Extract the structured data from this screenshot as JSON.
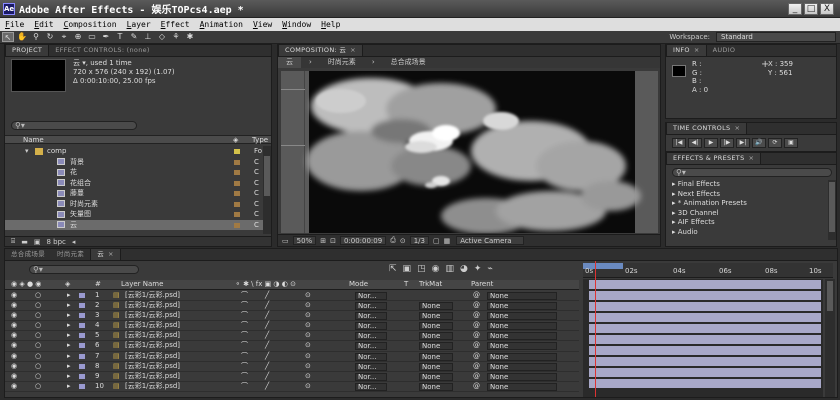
{
  "app": {
    "title": "Adobe After Effects - 娱乐TOPcs4.aep *",
    "icon_letter": "Ae",
    "win_buttons": [
      "_",
      "□",
      "X"
    ]
  },
  "menu": [
    "File",
    "Edit",
    "Composition",
    "Layer",
    "Effect",
    "Animation",
    "View",
    "Window",
    "Help"
  ],
  "toolbar": {
    "workspace_label": "Workspace:",
    "workspace_value": "Standard"
  },
  "project_panel": {
    "tabs": [
      "PROJECT",
      "EFFECT CONTROLS: (none)"
    ],
    "info_line1": "云 ▾, used 1 time",
    "info_line2": "720 x 576  (240 x 192) (1.07)",
    "info_line3": "Δ 0:00:10:00, 25.00 fps",
    "search_icon": "search-icon",
    "columns": {
      "name": "Name",
      "type": "Type"
    },
    "items": [
      {
        "label": "comp",
        "kind": "folder",
        "type": "Fo"
      },
      {
        "label": "背景",
        "kind": "comp",
        "type": "C"
      },
      {
        "label": "花",
        "kind": "comp",
        "type": "C"
      },
      {
        "label": "花组合",
        "kind": "comp",
        "type": "C"
      },
      {
        "label": "藤蔓",
        "kind": "comp",
        "type": "C"
      },
      {
        "label": "时尚元素",
        "kind": "comp",
        "type": "C"
      },
      {
        "label": "矢量图",
        "kind": "comp",
        "type": "C"
      },
      {
        "label": "云",
        "kind": "comp",
        "type": "C"
      }
    ],
    "bpc": "8 bpc"
  },
  "comp_panel": {
    "tab": "COMPOSITION: 云",
    "breadcrumbs": [
      "云",
      "时尚元素",
      "总合成场景"
    ],
    "zoom": "50%",
    "timecode": "0:00:00:09",
    "resolution": "1/3",
    "camera": "Active Camera"
  },
  "info_panel": {
    "tabs": [
      "INFO",
      "AUDIO"
    ],
    "r": "R :",
    "g": "G :",
    "b": "B :",
    "a": "A : 0",
    "x": "X : 359",
    "y": "Y : 561"
  },
  "time_controls": {
    "tab": "TIME CONTROLS",
    "buttons": [
      "|◀",
      "◀|",
      "▶",
      "|▶",
      "▶|",
      "🔊",
      "⟳",
      "▣"
    ]
  },
  "effects_panel": {
    "tab": "EFFECTS & PRESETS",
    "items": [
      "Final Effects",
      "Next Effects",
      "* Animation Presets",
      "3D Channel",
      "AIF Effects",
      "Audio"
    ]
  },
  "timeline": {
    "tabs": [
      "总合成场景",
      "时尚元素",
      "云"
    ],
    "columns": {
      "layer_name": "Layer Name",
      "mode": "Mode",
      "t": "T",
      "trkmat": "TrkMat",
      "parent": "Parent"
    },
    "ruler_labels": [
      "0s",
      "02s",
      "04s",
      "06s",
      "08s",
      "10s"
    ],
    "layers": [
      {
        "num": "1",
        "name": "[云彩1/云彩.psd]",
        "mode": "Nor...",
        "trkmat": "",
        "parent": "None"
      },
      {
        "num": "2",
        "name": "[云彩1/云彩.psd]",
        "mode": "Nor...",
        "trkmat": "None",
        "parent": "None"
      },
      {
        "num": "3",
        "name": "[云彩1/云彩.psd]",
        "mode": "Nor...",
        "trkmat": "None",
        "parent": "None"
      },
      {
        "num": "4",
        "name": "[云彩1/云彩.psd]",
        "mode": "Nor...",
        "trkmat": "None",
        "parent": "None"
      },
      {
        "num": "5",
        "name": "[云彩1/云彩.psd]",
        "mode": "Nor...",
        "trkmat": "None",
        "parent": "None"
      },
      {
        "num": "6",
        "name": "[云彩1/云彩.psd]",
        "mode": "Nor...",
        "trkmat": "None",
        "parent": "None"
      },
      {
        "num": "7",
        "name": "[云彩1/云彩.psd]",
        "mode": "Nor...",
        "trkmat": "None",
        "parent": "None"
      },
      {
        "num": "8",
        "name": "[云彩1/云彩.psd]",
        "mode": "Nor...",
        "trkmat": "None",
        "parent": "None"
      },
      {
        "num": "9",
        "name": "[云彩1/云彩.psd]",
        "mode": "Nor...",
        "trkmat": "None",
        "parent": "None"
      },
      {
        "num": "10",
        "name": "[云彩1/云彩.psd]",
        "mode": "Nor...",
        "trkmat": "None",
        "parent": "None"
      }
    ]
  },
  "colors": {
    "bar": "#a8a8c8",
    "playhead": "#dd3333",
    "label": "#a07a44"
  }
}
